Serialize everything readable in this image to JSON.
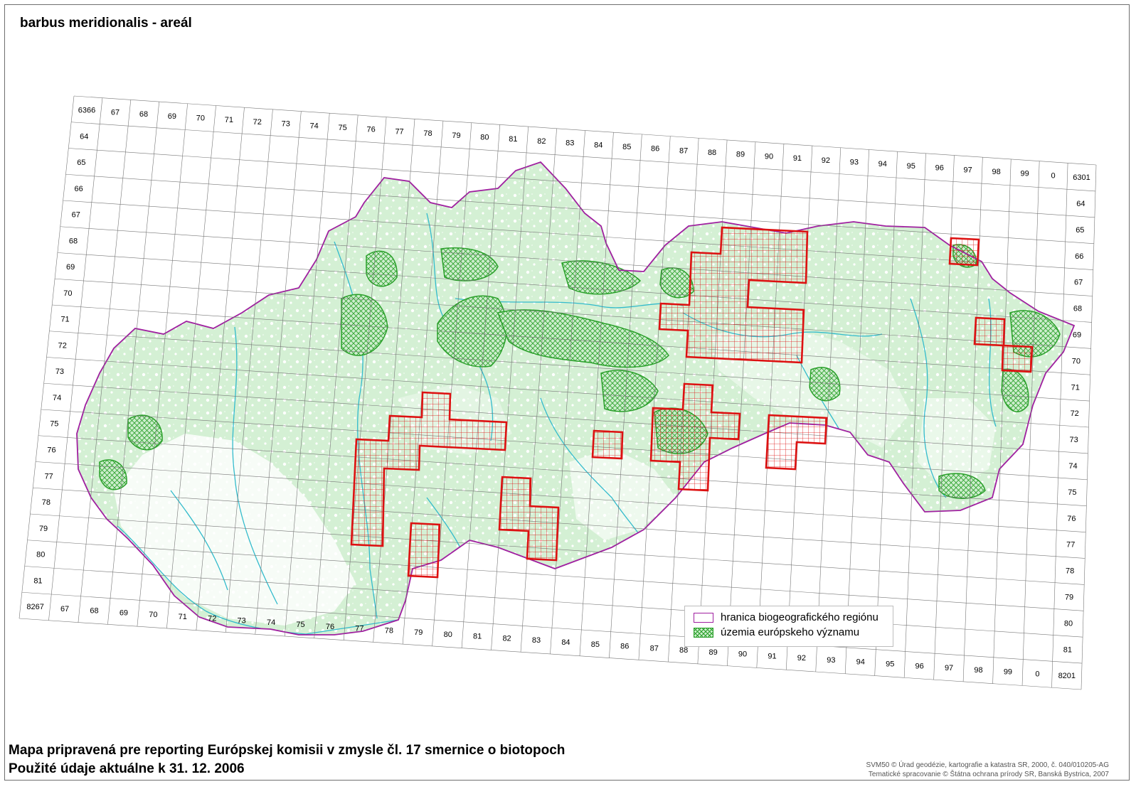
{
  "map": {
    "title": "barbus meridionalis - areál",
    "footer_line_1": "Mapa pripravená pre reporting Európskej komisii v zmysle čl. 17 smernice o biotopoch",
    "footer_line_2": "Použité údaje aktuálne k 31. 12. 2006",
    "credit_1": "SVM50 © Úrad geodézie, kartografie a katastra SR, 2000, č. 040/010205-AG",
    "credit_2": "Tematické spracovanie © Štátna ochrana prírody SR, Banská Bystrica, 2007",
    "grid": {
      "top_columns": [
        "6366",
        "67",
        "68",
        "69",
        "70",
        "71",
        "72",
        "73",
        "74",
        "75",
        "76",
        "77",
        "78",
        "79",
        "80",
        "81",
        "82",
        "83",
        "84",
        "85",
        "86",
        "87",
        "88",
        "89",
        "90",
        "91",
        "92",
        "93",
        "94",
        "95",
        "96",
        "97",
        "98",
        "99",
        "0",
        "6301"
      ],
      "bottom_columns": [
        "8267",
        "67",
        "68",
        "69",
        "70",
        "71",
        "72",
        "73",
        "74",
        "75",
        "76",
        "77",
        "78",
        "79",
        "80",
        "81",
        "82",
        "83",
        "84",
        "85",
        "86",
        "87",
        "88",
        "89",
        "90",
        "91",
        "92",
        "93",
        "94",
        "95",
        "96",
        "97",
        "98",
        "99",
        "0",
        "8201"
      ],
      "left_rows": [
        "64",
        "65",
        "66",
        "67",
        "68",
        "69",
        "70",
        "71",
        "72",
        "73",
        "74",
        "75",
        "76",
        "77",
        "78",
        "79",
        "80",
        "81"
      ],
      "right_rows": [
        "64",
        "65",
        "66",
        "67",
        "68",
        "69",
        "70",
        "71",
        "72",
        "73",
        "74",
        "75",
        "76",
        "77",
        "78",
        "79",
        "80",
        "81"
      ]
    },
    "legend": {
      "items": [
        {
          "label": "hranica biogeografického regiónu"
        },
        {
          "label": "územia európskeho významu"
        }
      ]
    },
    "colors": {
      "region_border": "#a020a0",
      "sci_sites": "#2aa02a",
      "occupied_cells": "#dd1111",
      "rivers": "#33bbcc",
      "land_fill": "#cfefcf"
    }
  }
}
